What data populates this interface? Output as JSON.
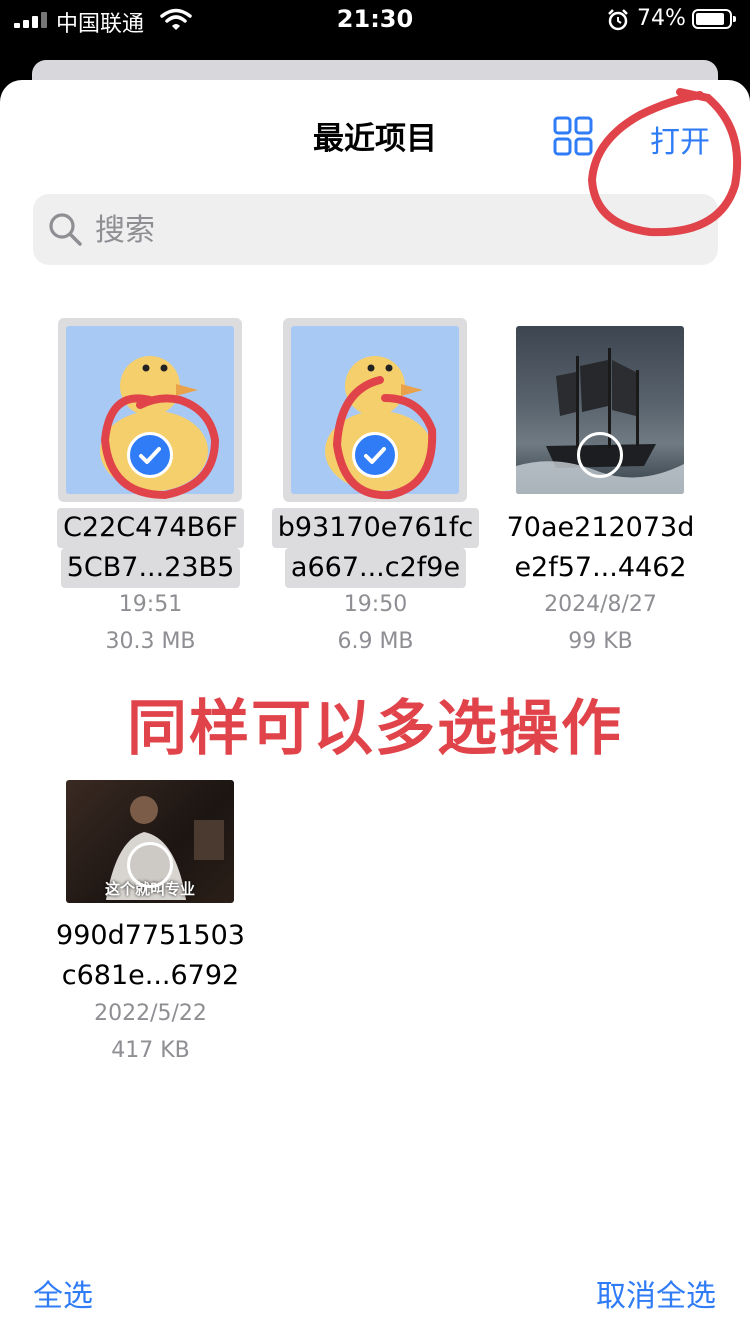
{
  "status_bar": {
    "carrier": "中国联通",
    "time": "21:30",
    "battery_percent": "74%"
  },
  "header": {
    "title": "最近项目",
    "grid_icon": "grid-icon",
    "open_label": "打开"
  },
  "search": {
    "placeholder": "搜索",
    "icon": "search-icon"
  },
  "files": [
    {
      "name_line1": "C22C474B6F",
      "name_line2": "5CB7...23B5",
      "date": "19:51",
      "size": "30.3 MB",
      "selected": true
    },
    {
      "name_line1": "b93170e761fc",
      "name_line2": "a667...c2f9e",
      "date": "19:50",
      "size": "6.9 MB",
      "selected": true
    },
    {
      "name_line1": "70ae212073d",
      "name_line2": "e2f57...4462",
      "date": "2024/8/27",
      "size": "99 KB",
      "selected": false
    },
    {
      "name_line1": "990d7751503",
      "name_line2": "c681e...6792",
      "date": "2022/5/22",
      "size": "417 KB",
      "selected": false,
      "thumb_caption": "这个就叫专业"
    }
  ],
  "annotation": {
    "text": "同样可以多选操作",
    "color": "#e0444a"
  },
  "footer": {
    "select_all": "全选",
    "deselect_all": "取消全选"
  },
  "colors": {
    "accent": "#2f7cf6",
    "secondary_text": "#8e8e93",
    "duck_bg": "#a9c9f5"
  }
}
